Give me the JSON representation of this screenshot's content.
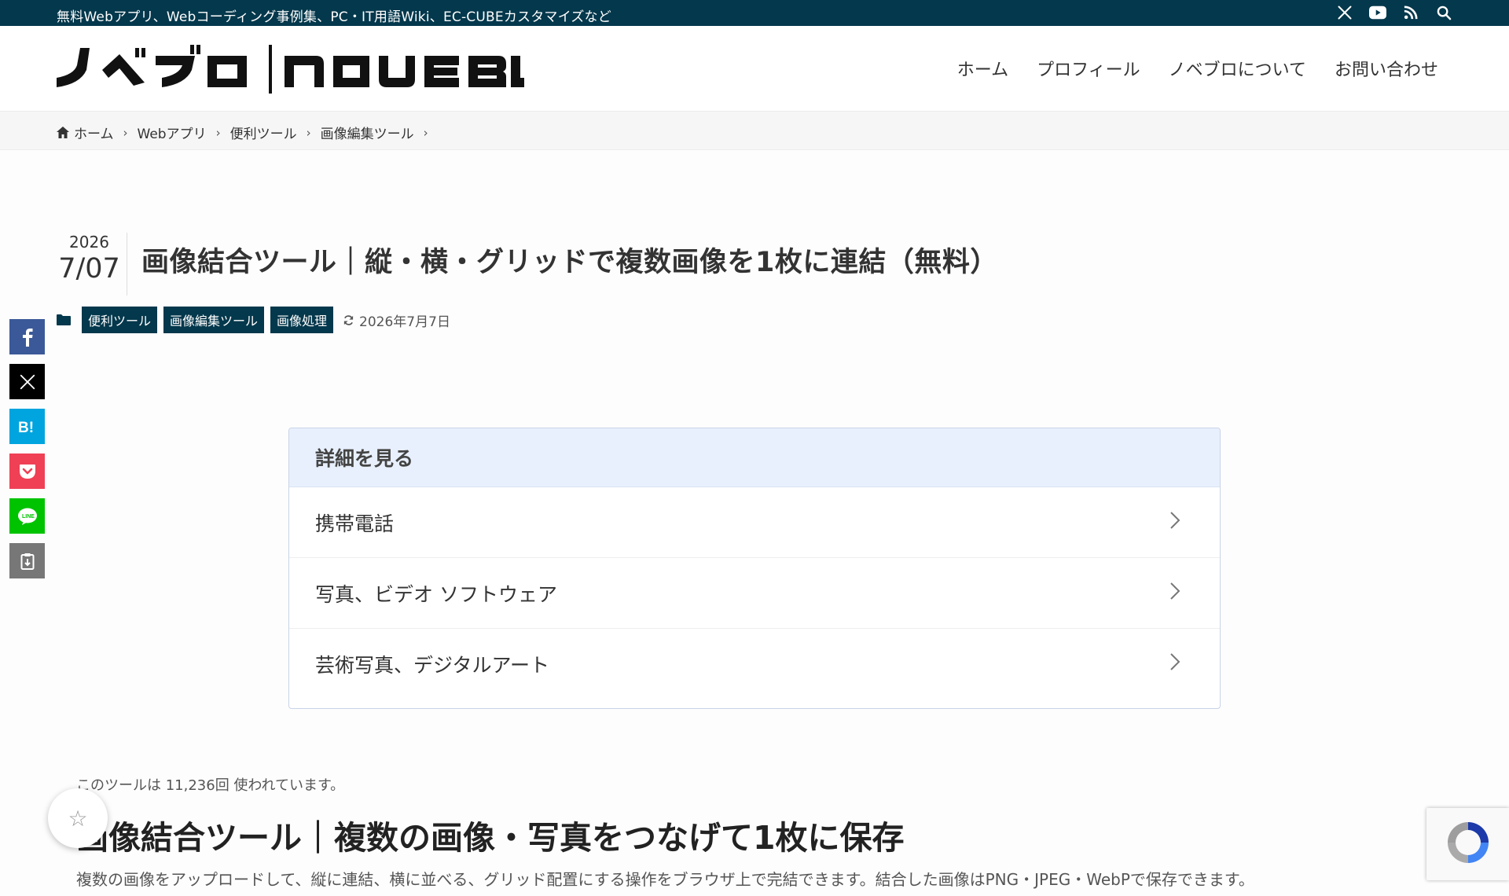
{
  "topbar": {
    "tagline": "無料Webアプリ、Webコーディング事例集、PC・IT用語Wiki、EC-CUBEカスタマイズなど",
    "icons": [
      "x-icon",
      "youtube-icon",
      "rss-icon",
      "search-icon"
    ]
  },
  "header": {
    "logo_text": "ノベブロ|NOVEBLO",
    "nav": [
      "ホーム",
      "プロフィール",
      "ノベブロについて",
      "お問い合わせ"
    ]
  },
  "breadcrumb": [
    "ホーム",
    "Webアプリ",
    "便利ツール",
    "画像編集ツール"
  ],
  "post": {
    "date_year": "2026",
    "date_md": "7/07",
    "title": "画像結合ツール｜縦・横・グリッドで複数画像を1枚に連結（無料）",
    "categories": [
      "便利ツール",
      "画像編集ツール",
      "画像処理"
    ],
    "updated": "2026年7月7日"
  },
  "share": {
    "buttons": [
      "facebook-icon",
      "x-icon",
      "hatena-icon",
      "pocket-icon",
      "line-icon",
      "clipboard-icon"
    ],
    "colors": [
      "#3b5998",
      "#000000",
      "#00a4de",
      "#ef4056",
      "#00c300",
      "#777777"
    ]
  },
  "details": {
    "header": "詳細を見る",
    "rows": [
      "携帯電話",
      "写真、ビデオ ソフトウェア",
      "芸術写真、デジタルアート"
    ]
  },
  "content": {
    "usage": "このツールは 11,236回 使われています。",
    "section_title": "画像結合ツール｜複数の画像・写真をつなげて1枚に保存",
    "section_desc": "複数の画像をアップロードして、縦に連結、横に並べる、グリッド配置にする操作をブラウザ上で完結できます。結合した画像はPNG・JPEG・WebPで保存できます。"
  },
  "colors": {
    "brand": "#04384c",
    "details_header_bg": "#e8f0fd"
  }
}
